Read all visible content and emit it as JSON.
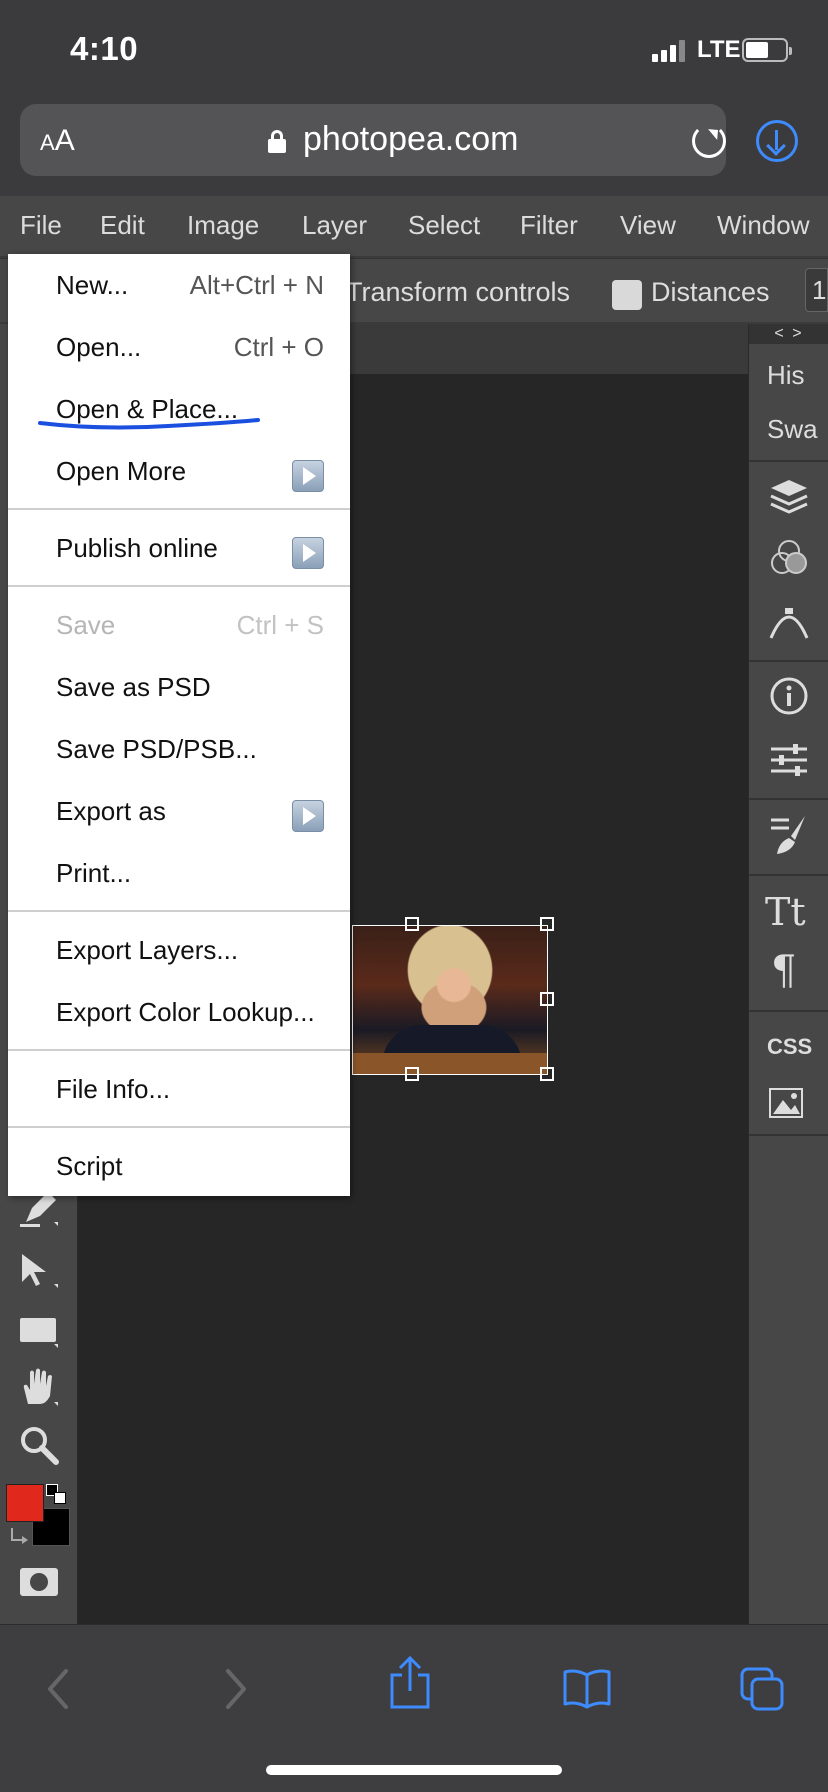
{
  "status_bar": {
    "time": "4:10",
    "network": "LTE"
  },
  "browser": {
    "text_size_button": "AA",
    "url": "photopea.com"
  },
  "menubar": {
    "items": [
      "File",
      "Edit",
      "Image",
      "Layer",
      "Select",
      "Filter",
      "View",
      "Window"
    ]
  },
  "options_bar": {
    "transform_controls": "Transform controls",
    "distances": "Distances",
    "trailing": "1"
  },
  "right_panel": {
    "arrows": "< >",
    "history_tab": "His",
    "swatches_tab": "Swa",
    "css_label": "CSS"
  },
  "file_menu": {
    "new": {
      "label": "New...",
      "shortcut": "Alt+Ctrl + N"
    },
    "open": {
      "label": "Open...",
      "shortcut": "Ctrl + O"
    },
    "open_place": {
      "label": "Open & Place..."
    },
    "open_more": {
      "label": "Open More"
    },
    "publish_online": {
      "label": "Publish online"
    },
    "save": {
      "label": "Save",
      "shortcut": "Ctrl + S",
      "enabled": false
    },
    "save_psd": {
      "label": "Save as PSD"
    },
    "save_psd_psb": {
      "label": "Save PSD/PSB..."
    },
    "export_as": {
      "label": "Export as"
    },
    "print": {
      "label": "Print..."
    },
    "export_layers": {
      "label": "Export Layers..."
    },
    "export_color_lookup": {
      "label": "Export Color Lookup..."
    },
    "file_info": {
      "label": "File Info..."
    },
    "script": {
      "label": "Script"
    }
  },
  "colors": {
    "foreground": "#e0281c",
    "background": "#000000",
    "accent": "#3d8bfd",
    "annotation": "#1a4fe0"
  }
}
